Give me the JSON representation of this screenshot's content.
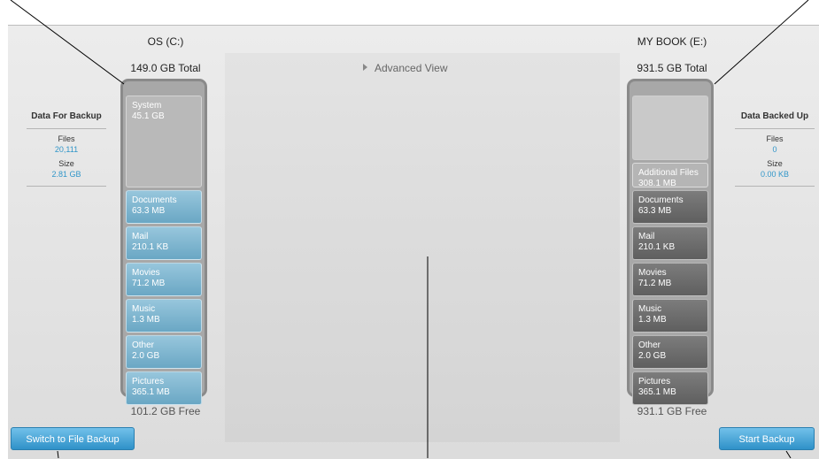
{
  "source_drive": {
    "name": "OS (C:)",
    "total": "149.0 GB Total",
    "free": "101.2 GB Free",
    "segments": [
      {
        "label": "System",
        "value": "45.1 GB",
        "kind": "system"
      },
      {
        "label": "Documents",
        "value": "63.3 MB",
        "kind": "blue"
      },
      {
        "label": "Mail",
        "value": "210.1 KB",
        "kind": "blue"
      },
      {
        "label": "Movies",
        "value": "71.2 MB",
        "kind": "blue"
      },
      {
        "label": "Music",
        "value": "1.3 MB",
        "kind": "blue"
      },
      {
        "label": "Other",
        "value": "2.0 GB",
        "kind": "blue"
      },
      {
        "label": "Pictures",
        "value": "365.1 MB",
        "kind": "blue"
      }
    ]
  },
  "backup_drive": {
    "name": "MY BOOK (E:)",
    "total": "931.5 GB Total",
    "free": "931.1 GB Free",
    "segments": [
      {
        "label": "",
        "value": "",
        "kind": "empty"
      },
      {
        "label": "Additional Files",
        "value": "308.1 MB",
        "kind": "additional"
      },
      {
        "label": "Documents",
        "value": "63.3 MB",
        "kind": "gray"
      },
      {
        "label": "Mail",
        "value": "210.1 KB",
        "kind": "gray"
      },
      {
        "label": "Movies",
        "value": "71.2 MB",
        "kind": "gray"
      },
      {
        "label": "Music",
        "value": "1.3 MB",
        "kind": "gray"
      },
      {
        "label": "Other",
        "value": "2.0 GB",
        "kind": "gray"
      },
      {
        "label": "Pictures",
        "value": "365.1 MB",
        "kind": "gray"
      }
    ]
  },
  "data_for_backup": {
    "title": "Data For Backup",
    "files_label": "Files",
    "files_value": "20,111",
    "size_label": "Size",
    "size_value": "2.81 GB"
  },
  "data_backed_up": {
    "title": "Data Backed Up",
    "files_label": "Files",
    "files_value": "0",
    "size_label": "Size",
    "size_value": "0.00 KB"
  },
  "advanced_view_label": "Advanced View",
  "switch_button_label": "Switch to File Backup",
  "start_button_label": "Start Backup",
  "colors": {
    "accent": "#3196c9",
    "button": "#2f91c8",
    "source_segment": "#6aa7c4",
    "backup_segment": "#6b6b6b"
  }
}
